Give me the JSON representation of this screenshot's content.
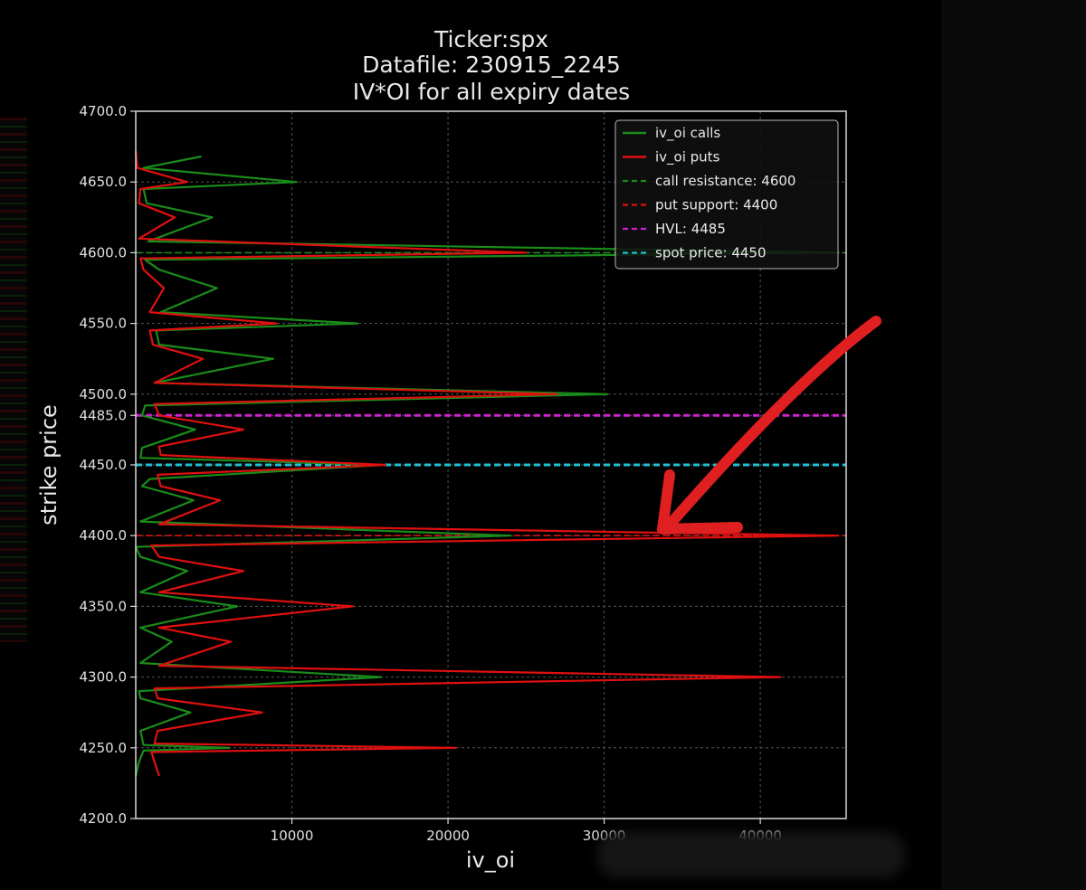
{
  "chart_data": {
    "type": "line",
    "title_lines": [
      "Ticker:spx",
      "Datafile: 230915_2245",
      "IV*OI for all expiry dates"
    ],
    "xlabel": "iv_oi",
    "ylabel": "strike price",
    "xlim": [
      0,
      45500
    ],
    "ylim": [
      4200,
      4700
    ],
    "xticks": [
      10000,
      20000,
      30000,
      40000
    ],
    "xtick_labels": [
      "10000",
      "20000",
      "30000",
      "40000"
    ],
    "yticks": [
      4200,
      4250,
      4300,
      4350,
      4400,
      4450,
      4485,
      4500,
      4550,
      4600,
      4650,
      4700
    ],
    "ytick_labels": [
      "4200.0",
      "4250.0",
      "4300.0",
      "4350.0",
      "4400.0",
      "4450.0",
      "4485.0",
      "4500.0",
      "4550.0",
      "4600.0",
      "4650.0",
      "4700.0"
    ],
    "grid": true,
    "legend_position": "top-right",
    "series": [
      {
        "name": "iv_oi calls",
        "color": "#1a8c1a",
        "style": "solid",
        "points": [
          [
            0,
            4230
          ],
          [
            200,
            4240
          ],
          [
            500,
            4248
          ],
          [
            6000,
            4250
          ],
          [
            500,
            4252
          ],
          [
            300,
            4262
          ],
          [
            3500,
            4275
          ],
          [
            300,
            4285
          ],
          [
            200,
            4290
          ],
          [
            15700,
            4300
          ],
          [
            300,
            4310
          ],
          [
            2300,
            4325
          ],
          [
            300,
            4335
          ],
          [
            6500,
            4350
          ],
          [
            300,
            4360
          ],
          [
            3300,
            4375
          ],
          [
            300,
            4385
          ],
          [
            0,
            4392
          ],
          [
            24000,
            4400
          ],
          [
            300,
            4410
          ],
          [
            3700,
            4425
          ],
          [
            400,
            4435
          ],
          [
            900,
            4440
          ],
          [
            15800,
            4450
          ],
          [
            300,
            4455
          ],
          [
            400,
            4462
          ],
          [
            3800,
            4475
          ],
          [
            400,
            4485
          ],
          [
            600,
            4492
          ],
          [
            30200,
            4500
          ],
          [
            1200,
            4508
          ],
          [
            8800,
            4525
          ],
          [
            1500,
            4535
          ],
          [
            1300,
            4545
          ],
          [
            14200,
            4550
          ],
          [
            1600,
            4558
          ],
          [
            5200,
            4575
          ],
          [
            1500,
            4588
          ],
          [
            600,
            4595
          ],
          [
            45000,
            4600
          ],
          [
            800,
            4608
          ],
          [
            4900,
            4625
          ],
          [
            700,
            4635
          ],
          [
            500,
            4645
          ],
          [
            10300,
            4650
          ],
          [
            500,
            4660
          ],
          [
            4200,
            4668
          ]
        ]
      },
      {
        "name": "iv_oi puts",
        "color": "#e01010",
        "style": "solid",
        "points": [
          [
            1500,
            4230
          ],
          [
            1200,
            4240
          ],
          [
            1000,
            4247
          ],
          [
            20500,
            4250
          ],
          [
            1200,
            4253
          ],
          [
            1400,
            4262
          ],
          [
            8100,
            4275
          ],
          [
            1400,
            4285
          ],
          [
            1200,
            4292
          ],
          [
            41300,
            4300
          ],
          [
            1500,
            4308
          ],
          [
            6100,
            4325
          ],
          [
            1500,
            4335
          ],
          [
            13900,
            4350
          ],
          [
            1500,
            4360
          ],
          [
            6900,
            4375
          ],
          [
            1500,
            4385
          ],
          [
            1000,
            4393
          ],
          [
            45000,
            4400
          ],
          [
            1500,
            4408
          ],
          [
            5400,
            4425
          ],
          [
            1600,
            4435
          ],
          [
            1400,
            4443
          ],
          [
            16000,
            4450
          ],
          [
            1600,
            4457
          ],
          [
            1500,
            4463
          ],
          [
            6900,
            4475
          ],
          [
            1500,
            4485
          ],
          [
            1200,
            4493
          ],
          [
            27000,
            4500
          ],
          [
            1200,
            4508
          ],
          [
            4300,
            4525
          ],
          [
            1100,
            4535
          ],
          [
            900,
            4545
          ],
          [
            9000,
            4550
          ],
          [
            900,
            4558
          ],
          [
            1800,
            4575
          ],
          [
            500,
            4588
          ],
          [
            300,
            4596
          ],
          [
            25000,
            4600
          ],
          [
            200,
            4610
          ],
          [
            2500,
            4625
          ],
          [
            200,
            4635
          ],
          [
            300,
            4645
          ],
          [
            3300,
            4650
          ],
          [
            100,
            4660
          ],
          [
            0,
            4672
          ]
        ]
      },
      {
        "name": "call resistance: 4600",
        "color": "#1a8c1a",
        "style": "dashed",
        "y": 4600
      },
      {
        "name": "put support: 4400",
        "color": "#e01010",
        "style": "dashed",
        "y": 4400
      },
      {
        "name": "HVL: 4485",
        "color": "#d020d0",
        "style": "dashed",
        "y": 4485
      },
      {
        "name": "spot price: 4450",
        "color": "#20c0d0",
        "style": "dashed",
        "y": 4450
      }
    ],
    "annotation": {
      "type": "arrow",
      "color": "#e02020"
    }
  }
}
